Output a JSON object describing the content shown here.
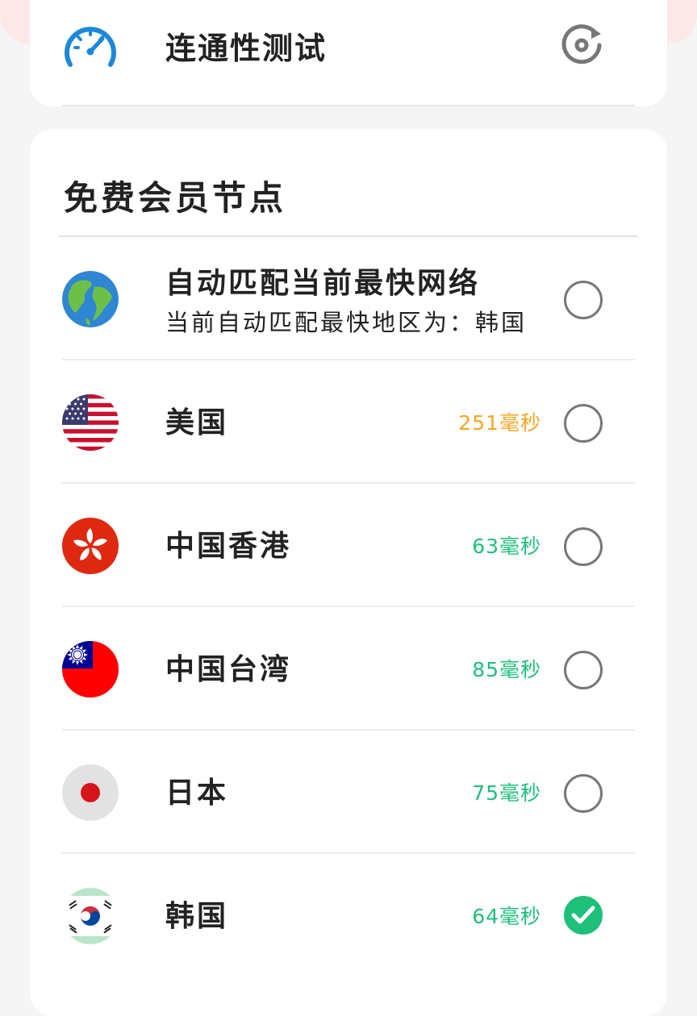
{
  "connectivity": {
    "title": "连通性测试",
    "icon": "speedometer-icon",
    "action_icon": "refresh-icon"
  },
  "section": {
    "title": "免费会员节点"
  },
  "nodes": [
    {
      "name": "自动匹配当前最快网络",
      "subtitle": "当前自动匹配最快地区为：韩国",
      "latency": "",
      "selected": false,
      "flag": "globe-icon"
    },
    {
      "name": "美国",
      "latency": "251毫秒",
      "latency_color": "#f5a623",
      "selected": false,
      "flag": "us-flag-icon"
    },
    {
      "name": "中国香港",
      "latency": "63毫秒",
      "latency_color": "#1ec07a",
      "selected": false,
      "flag": "hk-flag-icon"
    },
    {
      "name": "中国台湾",
      "latency": "85毫秒",
      "latency_color": "#1ec07a",
      "selected": false,
      "flag": "tw-flag-icon"
    },
    {
      "name": "日本",
      "latency": "75毫秒",
      "latency_color": "#1ec07a",
      "selected": false,
      "flag": "jp-flag-icon"
    },
    {
      "name": "韩国",
      "latency": "64毫秒",
      "latency_color": "#1ec07a",
      "selected": true,
      "flag": "kr-flag-icon"
    }
  ],
  "colors": {
    "accent_green": "#1ec07a",
    "warn_orange": "#f5a623",
    "icon_blue": "#1e88d8"
  }
}
